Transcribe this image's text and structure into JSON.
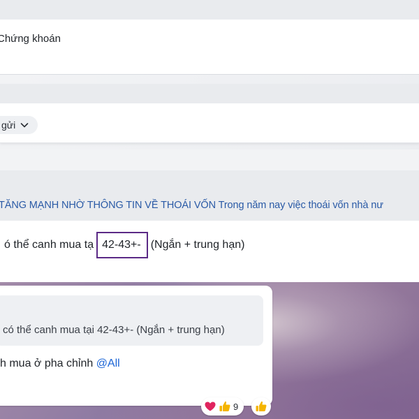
{
  "header": {
    "title": "Chứng khoán"
  },
  "sender": {
    "label": "gửi",
    "chevron_icon": "chevron-down-icon"
  },
  "headline": {
    "text": "TĂNG MẠNH NHỜ THÔNG TIN VỀ THOÁI VỐN Trong năm nay việc thoái vốn nhà nư"
  },
  "message": {
    "prefix": "ó thể canh mua tạ",
    "highlight": "42-43+-",
    "suffix": "(Ngắn + trung hạn)"
  },
  "chat": {
    "quote_text": "có thể canh mua tại 42-43+- (Ngắn + trung hạn)",
    "reply_text": "h  mua ở pha chỉnh ",
    "mention": "@All"
  },
  "reactions": {
    "items": [
      {
        "icon": "heart-icon",
        "color": "#e0245e"
      },
      {
        "icon": "thumbs-up-icon",
        "color": "#f4b400"
      }
    ],
    "count": "9",
    "quick_react_icon": "thumbs-up-icon"
  },
  "colors": {
    "highlight_border": "#5b2a86",
    "headline_text": "#2a5aa6",
    "mention": "#1a64d6"
  }
}
